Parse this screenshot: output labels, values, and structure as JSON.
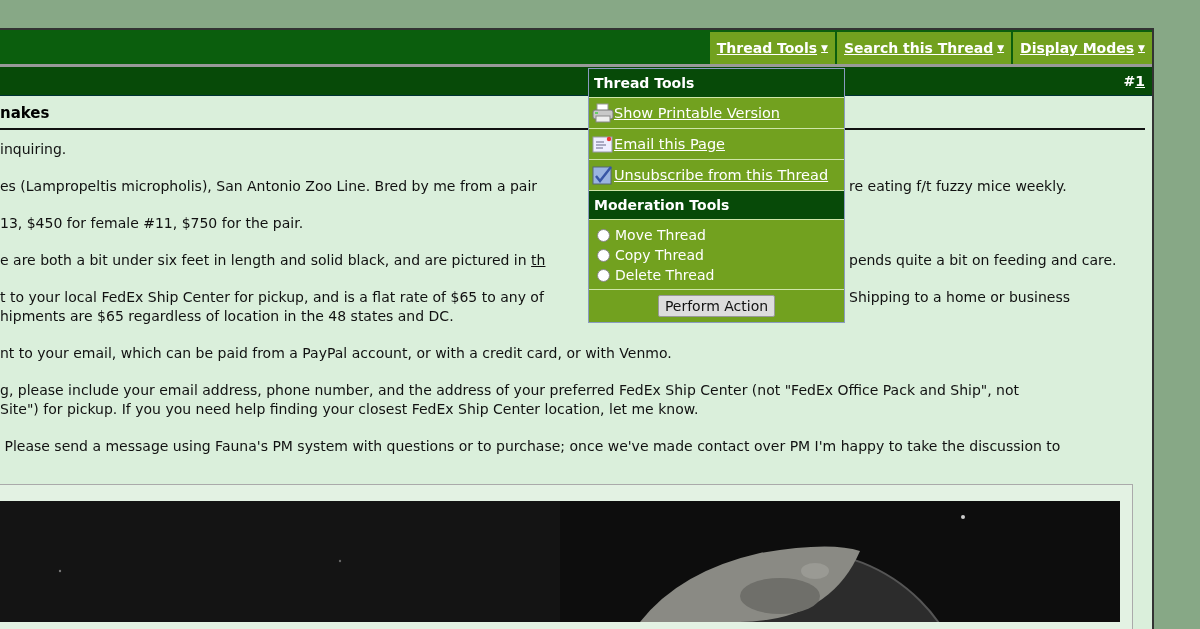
{
  "nav_tools": [
    {
      "label": "Thread Tools",
      "caret": "▼"
    },
    {
      "label": "Search this Thread",
      "caret": "▼"
    },
    {
      "label": "Display Modes",
      "caret": "▼"
    }
  ],
  "post_header": {
    "number_prefix": "#",
    "number_link": "1"
  },
  "post": {
    "title": "nakes",
    "paragraphs": [
      {
        "lines": [
          {
            "text": "inquiring."
          }
        ]
      },
      {
        "lines": [
          {
            "text": "es (Lampropeltis micropholis), San Antonio Zoo Line. Bred by me from a pair",
            "right": "re eating f/t fuzzy mice weekly."
          }
        ]
      },
      {
        "lines": [
          {
            "text": "13, $450 for female #11, $750 for the pair."
          }
        ]
      },
      {
        "lines": [
          {
            "text": "e are both a bit under six feet in length and solid black, and are pictured in ",
            "link": "th",
            "right": "pends quite a bit on feeding and care."
          }
        ]
      },
      {
        "lines": [
          {
            "text": "t to your local FedEx Ship Center for pickup, and is a flat rate of $65 to any of",
            "right": "Shipping to a home or business"
          },
          {
            "text": "hipments are $65 regardless of location in the 48 states and DC."
          }
        ]
      },
      {
        "lines": [
          {
            "text": "nt to your email, which can be paid from a PayPal account, or with a credit card, or with Venmo."
          }
        ]
      },
      {
        "lines": [
          {
            "text": "g, please include your email address, phone number, and the address of your preferred FedEx Ship Center (not \"FedEx Office Pack and Ship\", not"
          },
          {
            "text": "Site\") for pickup. If you you need help finding your closest FedEx Ship Center location, let me know."
          }
        ]
      },
      {
        "lines": [
          {
            "text": " Please send a message using Fauna's PM system with questions or to purchase; once we've made contact over PM I'm happy to take the discussion to"
          }
        ]
      }
    ]
  },
  "thread_tools_menu": {
    "title": "Thread Tools",
    "items": [
      {
        "label": " Show Printable Version",
        "kind": "printer"
      },
      {
        "label": " Email this Page",
        "kind": "email"
      },
      {
        "label": " Unsubscribe from this Thread",
        "kind": "unsubscribe"
      }
    ],
    "moderation_title": "Moderation Tools",
    "options": [
      {
        "label": "Move Thread",
        "selected": false
      },
      {
        "label": "Copy Thread",
        "selected": false
      },
      {
        "label": "Delete Thread",
        "selected": false
      }
    ],
    "action_button": "Perform Action"
  }
}
